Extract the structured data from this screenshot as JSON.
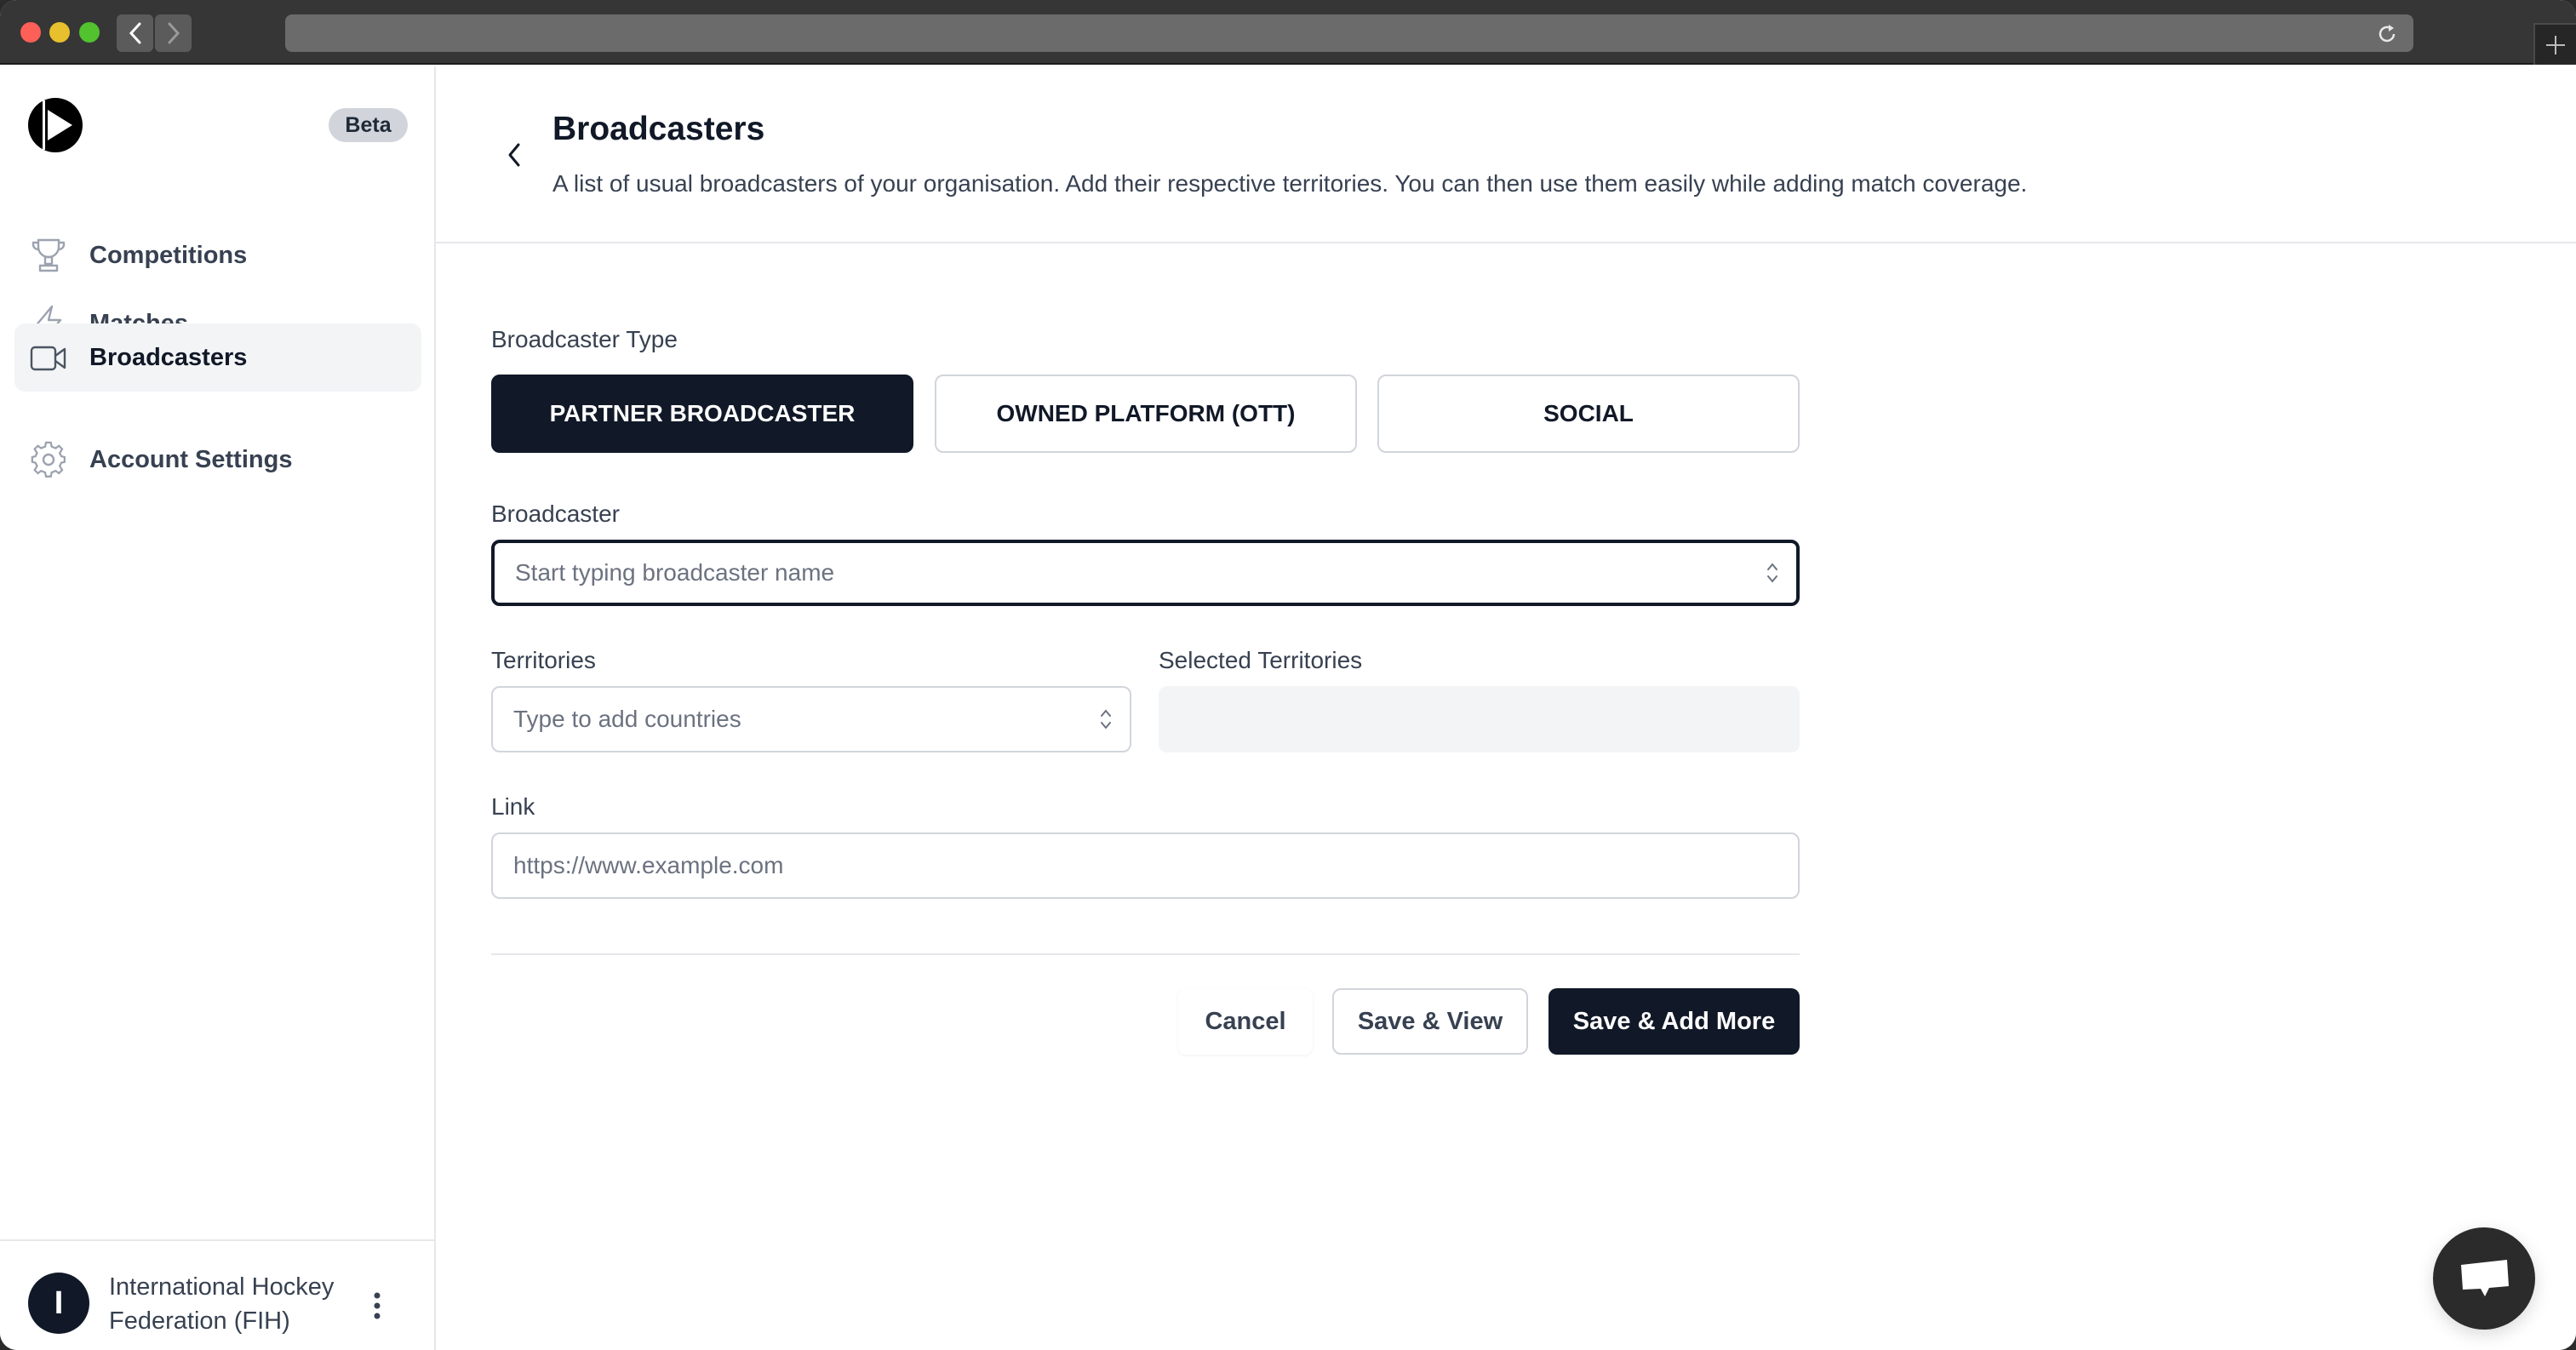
{
  "browser": {
    "back_icon": "chevron-left-icon",
    "forward_icon": "chevron-right-icon",
    "reload_icon": "reload-icon",
    "new_tab_icon": "plus-icon"
  },
  "sidebar": {
    "logo_icon": "play-logo-icon",
    "badge": "Beta",
    "items": [
      {
        "label": "Competitions",
        "icon": "trophy-icon",
        "active": false
      },
      {
        "label": "Matches",
        "icon": "lightning-icon",
        "active": false
      },
      {
        "label": "Broadcasters",
        "icon": "video-camera-icon",
        "active": true
      },
      {
        "label": "Account Settings",
        "icon": "gear-icon",
        "active": false
      }
    ],
    "organization": {
      "avatar_initial": "I",
      "name": "International Hockey Federation (FIH)",
      "menu_icon": "vertical-dots-icon"
    }
  },
  "header": {
    "back_icon": "chevron-left-icon",
    "title": "Broadcasters",
    "subtitle": "A list of usual broadcasters of your organisation. Add their respective territories. You can then use them easily while adding match coverage."
  },
  "form": {
    "broadcaster_type": {
      "label": "Broadcaster Type",
      "options": [
        "PARTNER BROADCASTER",
        "OWNED PLATFORM (OTT)",
        "SOCIAL"
      ],
      "selected": "PARTNER BROADCASTER"
    },
    "broadcaster": {
      "label": "Broadcaster",
      "placeholder": "Start typing broadcaster name",
      "value": ""
    },
    "territories": {
      "label": "Territories",
      "placeholder": "Type to add countries",
      "value": ""
    },
    "selected_territories": {
      "label": "Selected Territories",
      "items": []
    },
    "link": {
      "label": "Link",
      "placeholder": "https://www.example.com",
      "value": ""
    }
  },
  "actions": {
    "cancel": "Cancel",
    "save_view": "Save & View",
    "save_add_more": "Save & Add More"
  },
  "chat_widget": {
    "icon": "chat-bubble-icon"
  },
  "colors": {
    "primary": "#111827",
    "text": "#374151",
    "placeholder": "#6b7280",
    "border": "#d1d5db",
    "muted_bg": "#f3f4f6"
  }
}
